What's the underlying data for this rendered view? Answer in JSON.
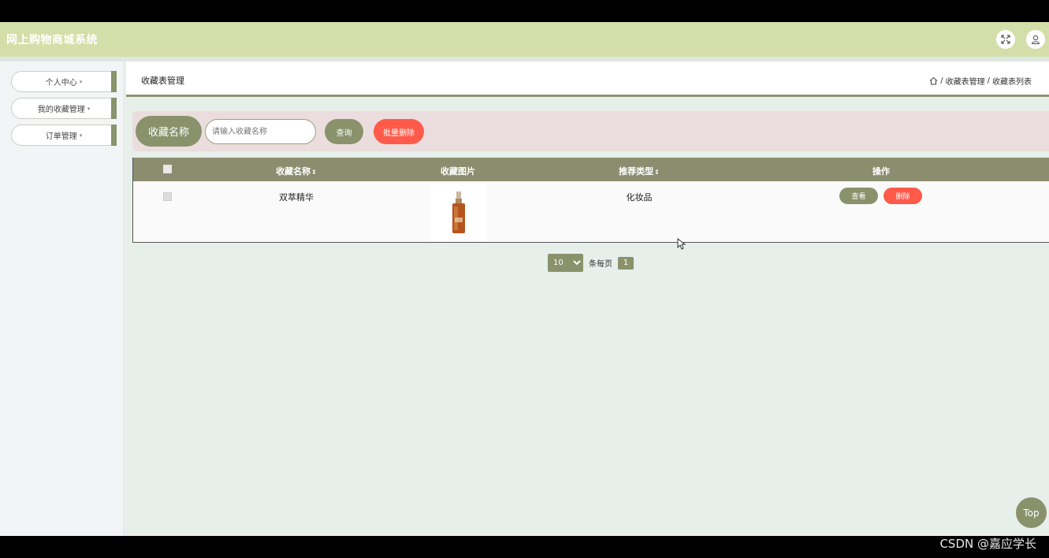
{
  "header": {
    "title": "网上购物商城系统"
  },
  "sidebar": {
    "items": [
      {
        "label": "个人中心"
      },
      {
        "label": "我的收藏管理"
      },
      {
        "label": "订单管理"
      }
    ]
  },
  "page": {
    "title": "收藏表管理",
    "breadcrumb": [
      "收藏表管理",
      "收藏表列表"
    ],
    "breadcrumb_sep": "/"
  },
  "search": {
    "label": "收藏名称",
    "placeholder": "请输入收藏名称",
    "query_label": "查询",
    "batch_delete_label": "批量删除"
  },
  "table": {
    "columns": [
      "收藏名称",
      "收藏图片",
      "推荐类型",
      "操作"
    ],
    "sort_glyph": "⇕",
    "rows": [
      {
        "name": "双萃精华",
        "type": "化妆品",
        "view_label": "查看",
        "delete_label": "删除"
      }
    ]
  },
  "pager": {
    "page_size": "10",
    "page_size_options": [
      "10"
    ],
    "per_page_label": "条每页",
    "current_page": "1"
  },
  "back_to_top": "Top",
  "watermark": "CSDN @嘉应学长",
  "colors": {
    "accent": "#8a926c",
    "header_bg": "#d4dea8",
    "danger": "#ff5a4a",
    "search_bg": "#ebdddd",
    "content_bg": "#e7efeb"
  },
  "icons": [
    "fullscreen-icon",
    "user-icon",
    "home-icon",
    "chevron-down-icon",
    "cursor-icon"
  ]
}
